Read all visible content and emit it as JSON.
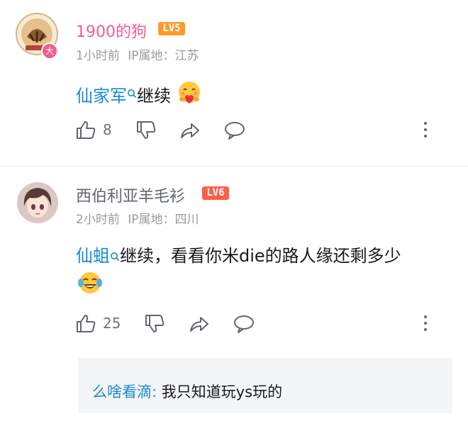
{
  "comments": [
    {
      "username": "1900的狗",
      "username_color": "#f25d8e",
      "level": "LV5",
      "level_color": "#ff9b2b",
      "avatar_badge": "大",
      "time": "1小时前",
      "ip_label": "IP属地：江苏",
      "mention": "仙家军",
      "text": "继续",
      "emoji": "hug-heart-emoji",
      "like_count": "8"
    },
    {
      "username": "西伯利亚羊毛衫",
      "username_color": "#61666d",
      "level": "LV6",
      "level_color": "#ff5f49",
      "time": "2小时前",
      "ip_label": "IP属地：四川",
      "mention": "仙蛆",
      "text_line1": "继续，看看你米die的路人缘还剩多少",
      "emoji": "tears-of-joy-emoji",
      "like_count": "25",
      "reply": {
        "author": "么啥看滴",
        "separator": ":",
        "text": " 我只知道玩ys玩的"
      }
    }
  ]
}
